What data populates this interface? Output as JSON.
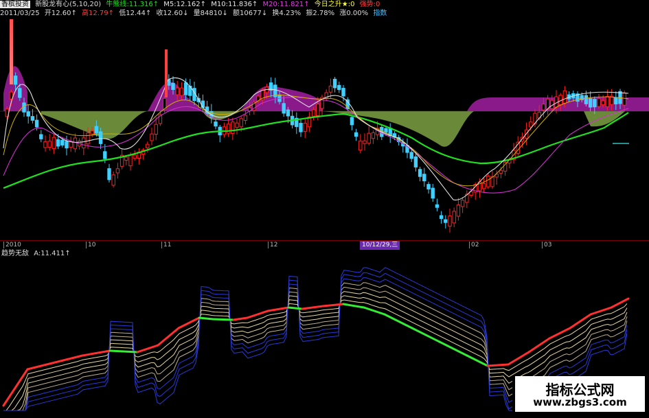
{
  "header1": {
    "app": "香槟投资",
    "indicator": "新股龙有心",
    "params": "(5,10,20)",
    "niuma_label": "牛熊线:",
    "niuma_value": "11.316↑",
    "m5": "M5:12.162↑",
    "m10": "M10:11.836↑",
    "m20": "M20:11.821↑",
    "today": "今日之升★:0",
    "strong": "强势:0"
  },
  "header2": {
    "date": "2011/03/25",
    "open": "开12.60↑",
    "high": "高12.79↑",
    "low": "低12.44↑",
    "close": "收12.60↓",
    "volume": "量84810↓",
    "amount": "额10677↓",
    "turnover": "换4.23%",
    "amplitude": "振2.78%",
    "change": "涨0.00%",
    "more": "指数"
  },
  "x_axis": {
    "ticks": [
      "2010",
      "10",
      "11",
      "12",
      "02",
      "03"
    ],
    "cursor_date": "10/12/29,三"
  },
  "indicator_panel": {
    "name": "趋势无敌",
    "value": "A:11.411↑"
  },
  "watermark": {
    "title": "指标公式网",
    "url": "www.zbgs3.com"
  },
  "colors": {
    "up": "#ff2020",
    "down": "#3fd0ff",
    "ma_white": "#e8e8e8",
    "ma_yellow": "#e0c000",
    "ma_magenta": "#e040e0",
    "ma_green": "#20e020",
    "cloud_green": "#6a8a3a",
    "cloud_purple": "#8a1a8a",
    "ribbon_low": "#ff3030",
    "ribbon_high": "#33ee33",
    "fan_tan": "#e8d8a0",
    "fan_blue": "#2a3ad8"
  }
}
